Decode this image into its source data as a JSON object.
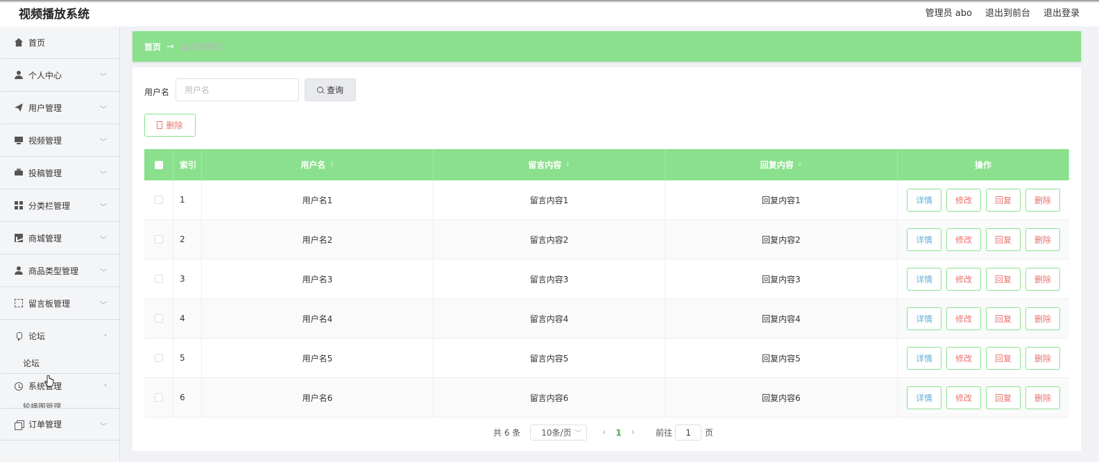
{
  "app": {
    "title": "视频播放系统"
  },
  "topbar": {
    "user_label": "管理员 abo",
    "front_link": "退出到前台",
    "logout_link": "退出登录"
  },
  "sidebar": {
    "items": [
      {
        "label": "首页",
        "icon": "home-icon"
      },
      {
        "label": "个人中心",
        "icon": "user-icon"
      },
      {
        "label": "用户管理",
        "icon": "send-icon"
      },
      {
        "label": "视频管理",
        "icon": "monitor-icon"
      },
      {
        "label": "投稿管理",
        "icon": "print-icon"
      },
      {
        "label": "分类栏管理",
        "icon": "grid-icon"
      },
      {
        "label": "商城管理",
        "icon": "chart-icon"
      },
      {
        "label": "商品类型管理",
        "icon": "user-icon"
      },
      {
        "label": "留言板管理",
        "icon": "scan-icon"
      },
      {
        "label": "论坛",
        "icon": "mic-icon"
      },
      {
        "label": "系统管理",
        "icon": "clock-icon"
      },
      {
        "label": "订单管理",
        "icon": "copy-icon"
      }
    ],
    "forum_sub": "论坛",
    "system_sub_cut": "轮播图管理"
  },
  "breadcrumb": {
    "home": "首页",
    "separator": "→",
    "current": "留言板管理"
  },
  "search": {
    "label": "用户名",
    "placeholder": "用户名",
    "value": "",
    "button": "查询"
  },
  "toolbar": {
    "delete_label": "删除"
  },
  "table": {
    "headers": {
      "index": "索引",
      "username": "用户名",
      "message": "留言内容",
      "reply": "回复内容",
      "actions": "操作"
    },
    "rows": [
      {
        "index": "1",
        "username": "用户名1",
        "message": "留言内容1",
        "reply": "回复内容1"
      },
      {
        "index": "2",
        "username": "用户名2",
        "message": "留言内容2",
        "reply": "回复内容2"
      },
      {
        "index": "3",
        "username": "用户名3",
        "message": "留言内容3",
        "reply": "回复内容3"
      },
      {
        "index": "4",
        "username": "用户名4",
        "message": "留言内容4",
        "reply": "回复内容4"
      },
      {
        "index": "5",
        "username": "用户名5",
        "message": "留言内容5",
        "reply": "回复内容5"
      },
      {
        "index": "6",
        "username": "用户名6",
        "message": "留言内容6",
        "reply": "回复内容6"
      }
    ],
    "actions": {
      "detail": "详情",
      "edit": "修改",
      "reply": "回复",
      "delete": "删除"
    }
  },
  "pagination": {
    "total": "共 6 条",
    "page_size": "10条/页",
    "current_page": "1",
    "goto_label": "前往",
    "goto_value": "1",
    "unit": "页"
  },
  "colors": {
    "accent": "#8ae08c",
    "danger": "#e8736f",
    "info": "#5bb0d9"
  }
}
